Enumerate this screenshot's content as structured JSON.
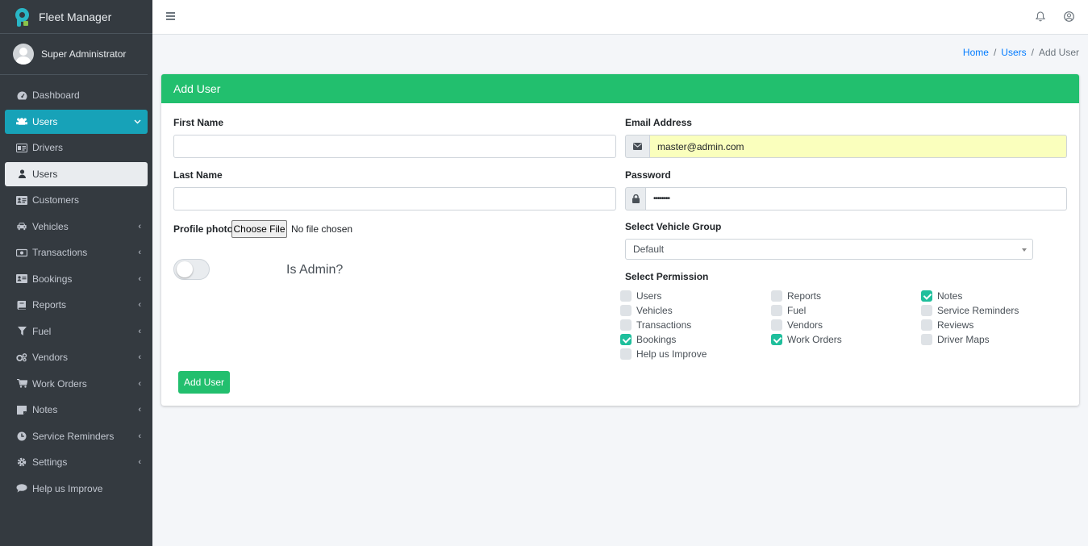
{
  "app": {
    "title": "Fleet Manager"
  },
  "user": {
    "name": "Super Administrator"
  },
  "sidebar": {
    "items": [
      {
        "label": "Dashboard",
        "icon": "dashboard-icon",
        "arrow": ""
      },
      {
        "label": "Users",
        "icon": "users-icon",
        "arrow": "⌄"
      },
      {
        "label": "Drivers",
        "icon": "id-card-icon",
        "arrow": ""
      },
      {
        "label": "Users",
        "icon": "user-icon",
        "arrow": ""
      },
      {
        "label": "Customers",
        "icon": "address-card-icon",
        "arrow": ""
      },
      {
        "label": "Vehicles",
        "icon": "car-icon",
        "arrow": "‹"
      },
      {
        "label": "Transactions",
        "icon": "money-icon",
        "arrow": "‹"
      },
      {
        "label": "Bookings",
        "icon": "address-book-icon",
        "arrow": "‹"
      },
      {
        "label": "Reports",
        "icon": "book-icon",
        "arrow": "‹"
      },
      {
        "label": "Fuel",
        "icon": "filter-icon",
        "arrow": "‹"
      },
      {
        "label": "Vendors",
        "icon": "cogs-icon",
        "arrow": "‹"
      },
      {
        "label": "Work Orders",
        "icon": "cart-icon",
        "arrow": "‹"
      },
      {
        "label": "Notes",
        "icon": "note-icon",
        "arrow": "‹"
      },
      {
        "label": "Service Reminders",
        "icon": "clock-icon",
        "arrow": "‹"
      },
      {
        "label": "Settings",
        "icon": "gear-icon",
        "arrow": "‹"
      },
      {
        "label": "Help us Improve",
        "icon": "comment-icon",
        "arrow": ""
      }
    ]
  },
  "breadcrumb": {
    "home": "Home",
    "users": "Users",
    "current": "Add User",
    "sep": "/"
  },
  "form": {
    "header": "Add User",
    "first_name_label": "First Name",
    "first_name_value": "",
    "last_name_label": "Last Name",
    "last_name_value": "",
    "email_label": "Email Address",
    "email_value": "master@admin.com",
    "password_label": "Password",
    "password_value": "••••••••",
    "profile_photo_label": "Profile photo",
    "choose_file": "Choose File",
    "file_status": "No file chosen",
    "is_admin_label": "Is Admin?",
    "is_admin": false,
    "vehicle_group_label": "Select Vehicle Group",
    "vehicle_group_value": "Default",
    "permission_label": "Select Permission",
    "submit": "Add User"
  },
  "permissions": [
    {
      "label": "Users",
      "checked": false
    },
    {
      "label": "Vehicles",
      "checked": false
    },
    {
      "label": "Transactions",
      "checked": false
    },
    {
      "label": "Bookings",
      "checked": true
    },
    {
      "label": "Help us Improve",
      "checked": false
    },
    {
      "label": "Reports",
      "checked": false
    },
    {
      "label": "Fuel",
      "checked": false
    },
    {
      "label": "Vendors",
      "checked": false
    },
    {
      "label": "Work Orders",
      "checked": true
    },
    {
      "label": "Notes",
      "checked": true
    },
    {
      "label": "Service Reminders",
      "checked": false
    },
    {
      "label": "Reviews",
      "checked": false
    },
    {
      "label": "Driver Maps",
      "checked": false
    }
  ],
  "colors": {
    "sidebar": "#343a40",
    "active": "#17a2b8",
    "header": "#22bf6e",
    "check": "#1fbf9c",
    "autofill": "#faffbd"
  }
}
